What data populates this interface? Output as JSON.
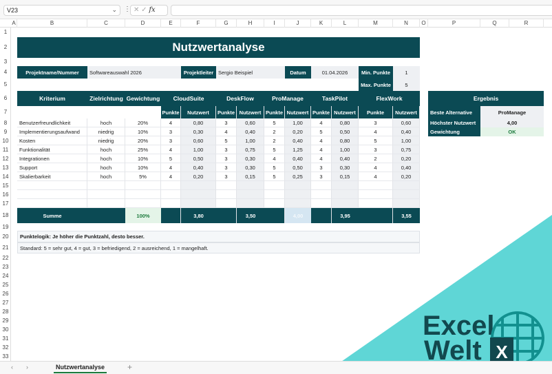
{
  "formula_bar": {
    "name_box": "V23",
    "fx": "fx",
    "cancel": "✕",
    "confirm": "✓",
    "formula": ""
  },
  "columns": [
    "A",
    "B",
    "C",
    "D",
    "E",
    "F",
    "G",
    "H",
    "I",
    "J",
    "K",
    "L",
    "M",
    "N",
    "O",
    "P",
    "Q",
    "R"
  ],
  "title": "Nutzwertanalyse",
  "project": {
    "name_label": "Projektname/Nummer",
    "name": "Softwareauswahl 2026",
    "lead_label": "Projektleiter",
    "lead": "Sergio Beispiel",
    "date_label": "Datum",
    "date": "01.04.2026",
    "min_label": "Min. Punkte",
    "min": "1",
    "max_label": "Max. Punkte",
    "max": "5"
  },
  "table": {
    "headers": {
      "criterion": "Kriterium",
      "direction": "Zielrichtung",
      "weight": "Gewichtung",
      "points": "Punkte",
      "value": "Nutzwert"
    },
    "alternatives": [
      "CloudSuite",
      "DeskFlow",
      "ProManage",
      "TaskPilot",
      "FlexWork"
    ],
    "rows": [
      {
        "criterion": "Benutzerfreundlichkeit",
        "direction": "hoch",
        "weight": "20%",
        "scores": [
          [
            "4",
            "0,80"
          ],
          [
            "3",
            "0,60"
          ],
          [
            "5",
            "1,00"
          ],
          [
            "4",
            "0,80"
          ],
          [
            "3",
            "0,60"
          ]
        ]
      },
      {
        "criterion": "Implementierungsaufwand",
        "direction": "niedrig",
        "weight": "10%",
        "scores": [
          [
            "3",
            "0,30"
          ],
          [
            "4",
            "0,40"
          ],
          [
            "2",
            "0,20"
          ],
          [
            "5",
            "0,50"
          ],
          [
            "4",
            "0,40"
          ]
        ]
      },
      {
        "criterion": "Kosten",
        "direction": "niedrig",
        "weight": "20%",
        "scores": [
          [
            "3",
            "0,60"
          ],
          [
            "5",
            "1,00"
          ],
          [
            "2",
            "0,40"
          ],
          [
            "4",
            "0,80"
          ],
          [
            "5",
            "1,00"
          ]
        ]
      },
      {
        "criterion": "Funktionalität",
        "direction": "hoch",
        "weight": "25%",
        "scores": [
          [
            "4",
            "1,00"
          ],
          [
            "3",
            "0,75"
          ],
          [
            "5",
            "1,25"
          ],
          [
            "4",
            "1,00"
          ],
          [
            "3",
            "0,75"
          ]
        ]
      },
      {
        "criterion": "Integrationen",
        "direction": "hoch",
        "weight": "10%",
        "scores": [
          [
            "5",
            "0,50"
          ],
          [
            "3",
            "0,30"
          ],
          [
            "4",
            "0,40"
          ],
          [
            "4",
            "0,40"
          ],
          [
            "2",
            "0,20"
          ]
        ]
      },
      {
        "criterion": "Support",
        "direction": "hoch",
        "weight": "10%",
        "scores": [
          [
            "4",
            "0,40"
          ],
          [
            "3",
            "0,30"
          ],
          [
            "5",
            "0,50"
          ],
          [
            "3",
            "0,30"
          ],
          [
            "4",
            "0,40"
          ]
        ]
      },
      {
        "criterion": "Skalierbarkeit",
        "direction": "hoch",
        "weight": "5%",
        "scores": [
          [
            "4",
            "0,20"
          ],
          [
            "3",
            "0,15"
          ],
          [
            "5",
            "0,25"
          ],
          [
            "3",
            "0,15"
          ],
          [
            "4",
            "0,20"
          ]
        ]
      }
    ],
    "sum_label": "Summe",
    "sum_weight": "100%",
    "sums": [
      "3,80",
      "3,50",
      "4,00",
      "3,95",
      "3,55"
    ]
  },
  "result": {
    "header": "Ergebnis",
    "best_label": "Beste Alternative",
    "best": "ProManage",
    "max_label": "Höchster Nutzwert",
    "max": "4,00",
    "weight_label": "Gewichtung",
    "weight": "OK"
  },
  "notes": {
    "line1": "Punktelogik: Je höher die Punktzahl, desto besser.",
    "line2": "Standard: 5 = sehr gut, 4 = gut, 3 = befriedigend, 2 = ausreichend, 1 = mangelhaft."
  },
  "sheet_tabs": {
    "active": "Nutzwertanalyse",
    "add": "+",
    "prev": "‹",
    "next": "›"
  },
  "logo": {
    "line1": "Excel",
    "line2": "Welt",
    "badge": "X"
  },
  "colors": {
    "header": "#0b4a54",
    "logo_bg": "#5fd6d6",
    "logo_text": "#12484e",
    "ok": "#1c7a3c"
  }
}
